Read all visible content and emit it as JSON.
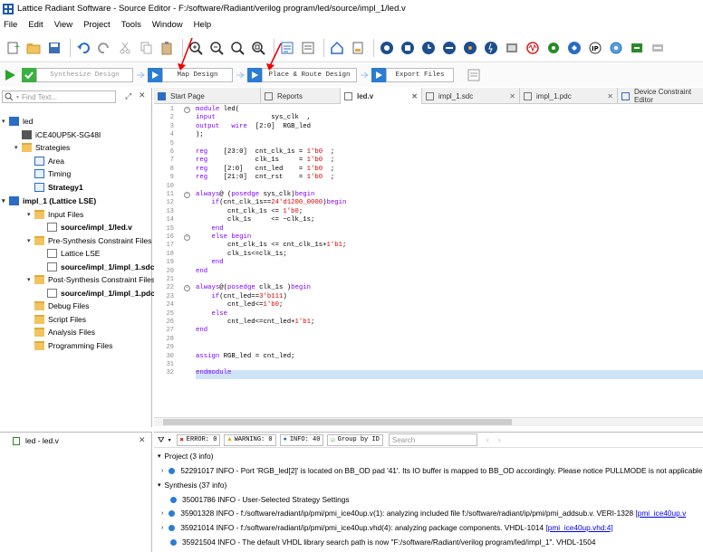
{
  "window": {
    "title": "Lattice Radiant Software - Source Editor - F:/software/Radiant/verilog program/led/source/impl_1/led.v"
  },
  "menu": [
    "File",
    "Edit",
    "View",
    "Project",
    "Tools",
    "Window",
    "Help"
  ],
  "flow": {
    "synthesize": "Synthesize Design",
    "map": "Map Design",
    "par": "Place & Route Design",
    "export": "Export Files"
  },
  "search": {
    "placeholder": "Find Text..."
  },
  "tree": {
    "project": "led",
    "device": "iCE40UP5K-SG48I",
    "strategies": "Strategies",
    "area": "Area",
    "timing": "Timing",
    "strategy1": "Strategy1",
    "impl": "impl_1 (Lattice LSE)",
    "input_files": "Input Files",
    "led_v": "source/impl_1/led.v",
    "pre_syn": "Pre-Synthesis Constraint Files",
    "lattice_lse": "Lattice LSE",
    "sdc": "source/impl_1/impl_1.sdc",
    "post_syn": "Post-Synthesis Constraint Files",
    "pdc": "source/impl_1/impl_1.pdc",
    "debug": "Debug Files",
    "script": "Script Files",
    "analysis": "Analysis Files",
    "programming": "Programming Files"
  },
  "tabs": [
    "Start Page",
    "Reports",
    "led.v",
    "impl_1.sdc",
    "impl_1.pdc",
    "Device Constraint Editor"
  ],
  "code": [
    "module led(",
    "input              sys_clk  ,",
    "output   wire  [2:0]  RGB_led",
    ");",
    "",
    "reg    [23:0]  cnt_clk_1s = 1'b0  ;",
    "reg            clk_1s     = 1'b0  ;",
    "reg    [2:0]   cnt_led    = 1'b0  ;",
    "reg    [21:0]  cnt_rst    = 1'b0  ;",
    "",
    "always@ (posedge sys_clk)begin",
    "    if(cnt_clk_1s==24'd1200_0000)begin",
    "        cnt_clk_1s <= 1'b0;",
    "        clk_1s     <= ~clk_1s;",
    "    end",
    "    else begin",
    "        cnt_clk_1s <= cnt_clk_1s+1'b1;",
    "        clk_1s<=clk_1s;",
    "    end",
    "end",
    "",
    "always@(posedge clk_1s )begin",
    "    if(cnt_led==3'b111)",
    "        cnt_led<=1'b0;",
    "    else",
    "        cnt_led<=cnt_led+1'b1;",
    "end",
    "",
    "",
    "assign RGB_led = cnt_led;",
    "",
    "endmodule"
  ],
  "line_numbers": [
    "1",
    "2",
    "3",
    "4",
    "5",
    "6",
    "7",
    "8",
    "9",
    "10",
    "11",
    "12",
    "13",
    "14",
    "15",
    "16",
    "17",
    "18",
    "19",
    "20",
    "21",
    "22",
    "23",
    "24",
    "25",
    "26",
    "27",
    "28",
    "29",
    "30",
    "31",
    "32"
  ],
  "bottom_left": {
    "item": "led - led.v"
  },
  "msgbar": {
    "error": "ERROR: 0",
    "warning": "WARNING: 0",
    "info": "INFO: 40",
    "group": "Group by ID",
    "search_placeholder": "Search"
  },
  "messages": {
    "project_header": "Project (3 info)",
    "m1": "52291017 INFO - Port 'RGB_led[2]' is located on BB_OD pad '41'. Its IO buffer is mapped to BB_OD accordingly. Please notice PULLMODE is not applicable",
    "synth_header": "Synthesis (37 info)",
    "m2": "35001786 INFO - User-Selected Strategy Settings",
    "m3": "35901328 INFO - f:/software/radiant/ip/pmi/pmi_ice40up.v(1): analyzing included file f:/software/radiant/ip/pmi/pmi_addsub.v. VERI-1328",
    "m3_link": "[pmi_ice40up.v",
    "m4": "35921014 INFO - f:/software/radiant/ip/pmi/pmi_ice40up.vhd(4): analyzing package components. VHDL-1014",
    "m4_link": "[pmi_ice40up.vhd:4]",
    "m5": "35921504 INFO - The default VHDL library search path is now \"F:/software/Radiant/verilog program/led/impl_1\". VHDL-1504"
  }
}
